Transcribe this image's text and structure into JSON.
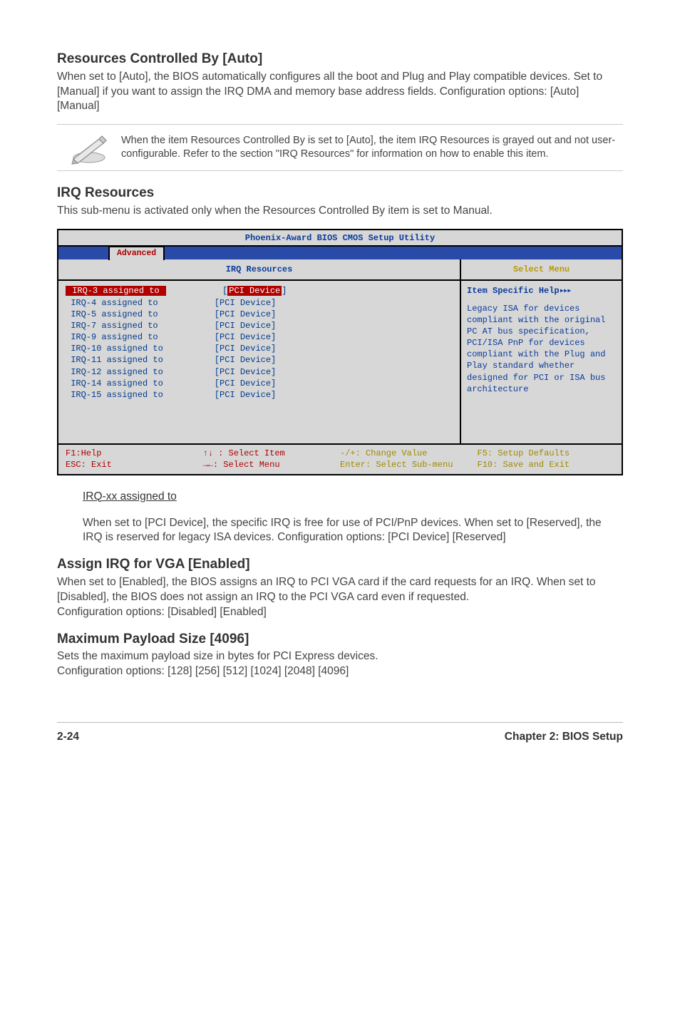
{
  "sections": {
    "rcb": {
      "title": "Resources Controlled By [Auto]",
      "body": "When set to [Auto], the BIOS automatically configures all the boot and Plug and Play compatible devices. Set to [Manual] if you want to assign the IRQ DMA and memory base address fields. Configuration options: [Auto] [Manual]"
    },
    "note": "When the item Resources Controlled By is set to [Auto], the item IRQ Resources is grayed out and not user-configurable. Refer to the section \"IRQ Resources\" for information on how to enable this item.",
    "irqres": {
      "title": "IRQ Resources",
      "body": "This sub-menu is activated only when the Resources Controlled By item is set to Manual."
    },
    "irqxx": {
      "title": "IRQ-xx assigned to",
      "body": "When set to [PCI Device], the specific IRQ is free for use of PCI/PnP devices. When set to [Reserved], the IRQ is reserved for legacy ISA devices. Configuration options: [PCI Device] [Reserved]"
    },
    "assignvga": {
      "title": "Assign IRQ for VGA [Enabled]",
      "body": "When set to [Enabled], the BIOS assigns an IRQ to PCI VGA card if the card requests for an IRQ. When set to [Disabled], the BIOS does not assign an IRQ to the PCI VGA card even if requested.\nConfiguration options: [Disabled] [Enabled]"
    },
    "maxpayload": {
      "title": "Maximum Payload Size [4096]",
      "body": "Sets the maximum payload size in bytes for PCI Express devices.\nConfiguration options: [128] [256] [512] [1024] [2048] [4096]"
    }
  },
  "bios": {
    "title": "Phoenix-Award BIOS CMOS Setup Utility",
    "tab": "Advanced",
    "panel_title": "IRQ Resources",
    "right_title": "Select Menu",
    "help_title": "Item Specific Help",
    "help_body": "Legacy ISA for devices compliant with the original PC AT bus specification, PCI/ISA PnP for devices compliant with the Plug and Play standard whether designed for PCI or ISA bus architecture",
    "rows": [
      {
        "label": "IRQ-3 assigned to",
        "value": "PCI Device",
        "hl_label": true,
        "hl_value": true
      },
      {
        "label": "IRQ-4 assigned to",
        "value": "[PCI Device]"
      },
      {
        "label": "IRQ-5 assigned to",
        "value": "[PCI Device]"
      },
      {
        "label": "IRQ-7 assigned to",
        "value": "[PCI Device]"
      },
      {
        "label": "IRQ-9 assigned to",
        "value": "[PCI Device]"
      },
      {
        "label": "IRQ-10 assigned to",
        "value": "[PCI Device]"
      },
      {
        "label": "IRQ-11 assigned to",
        "value": "[PCI Device]"
      },
      {
        "label": "IRQ-12 assigned to",
        "value": "[PCI Device]"
      },
      {
        "label": "IRQ-14 assigned to",
        "value": "[PCI Device]"
      },
      {
        "label": "IRQ-15 assigned to",
        "value": "[PCI Device]"
      }
    ],
    "footer": {
      "f1": "F1:Help",
      "nav1": "↑↓ : Select Item",
      "change": "-/+: Change Value",
      "f5": "F5: Setup Defaults",
      "esc": "ESC: Exit",
      "nav2": "→←: Select Menu",
      "enter": "Enter: Select Sub-menu",
      "f10": "F10: Save and Exit"
    }
  },
  "footer": {
    "left": "2-24",
    "right": "Chapter 2: BIOS Setup"
  }
}
